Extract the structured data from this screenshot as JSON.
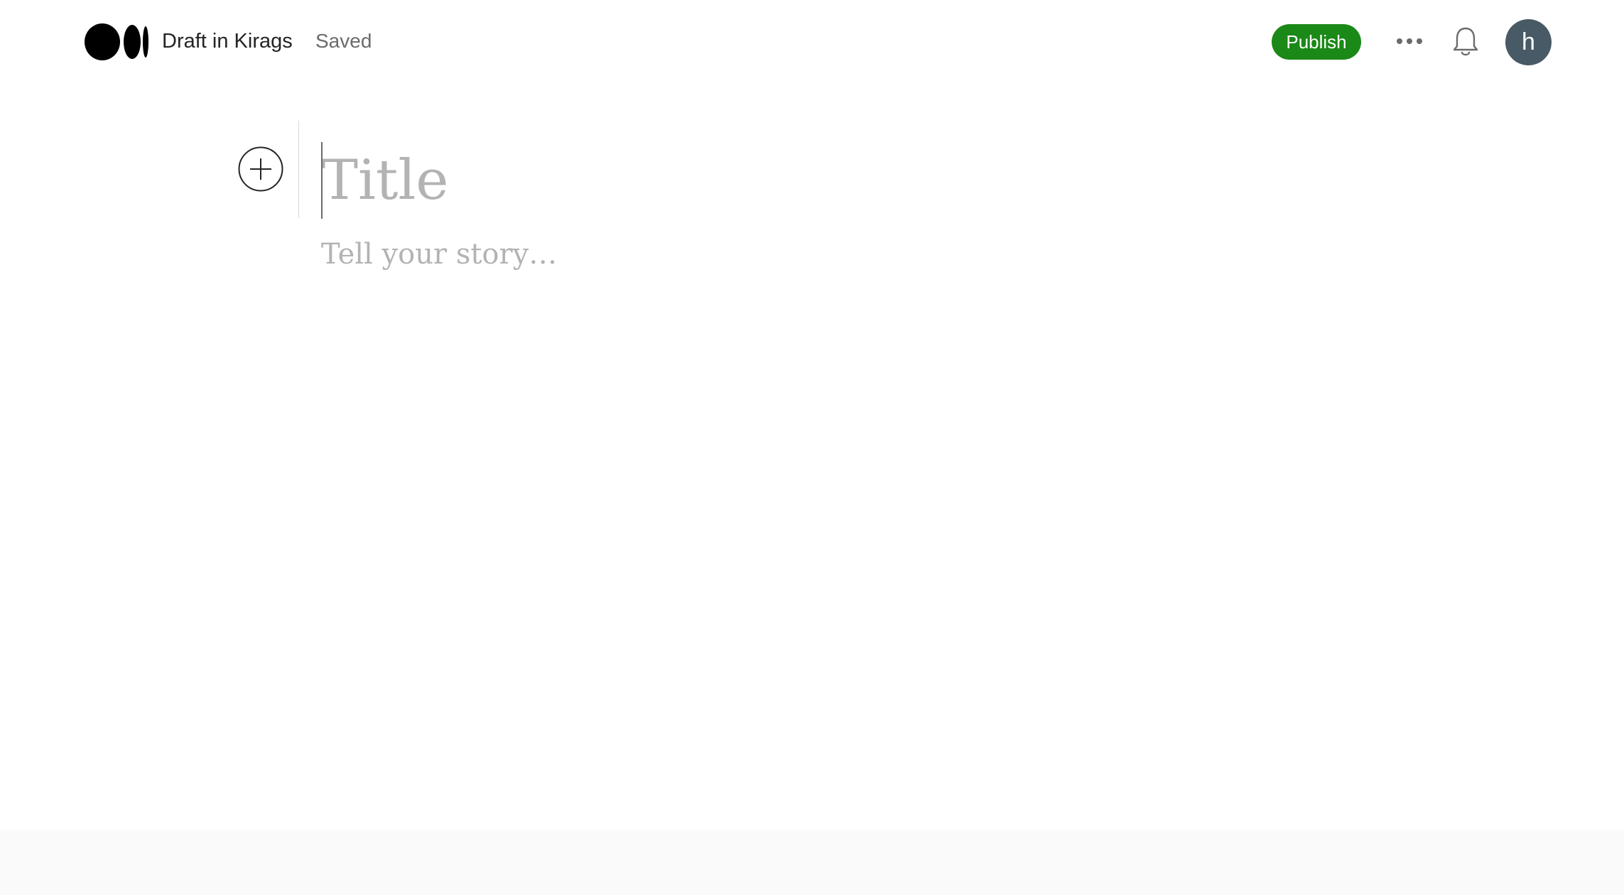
{
  "header": {
    "logo_icon": "medium-logo-icon",
    "draft_title": "Draft in Kirags",
    "save_status": "Saved",
    "publish_label": "Publish",
    "more_icon": "more-dots-icon",
    "notifications_icon": "bell-icon",
    "avatar_initial": "h"
  },
  "editor": {
    "add_block_icon": "plus-circle-icon",
    "title_placeholder": "Title",
    "story_placeholder": "Tell your story…"
  },
  "colors": {
    "publish_green": "#1a8917",
    "avatar_bg": "#475a65",
    "placeholder_text": "#b3b3b3",
    "primary_text": "#242424",
    "secondary_text": "#6b6b6b"
  }
}
